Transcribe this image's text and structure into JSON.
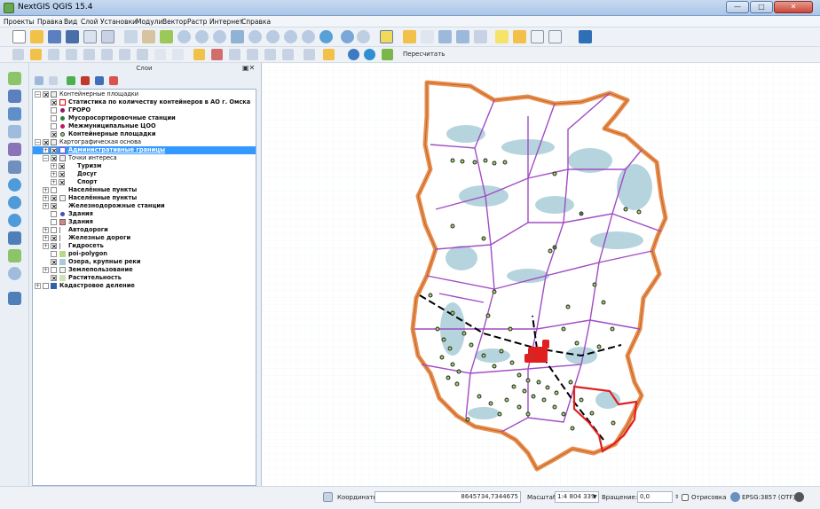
{
  "window": {
    "title": "NextGIS QGIS 15.4",
    "minimize": "—",
    "maximize": "□",
    "close": "✕"
  },
  "menu": [
    "Проекты",
    "Правка",
    "Вид",
    "Слой",
    "Установки",
    "Модули",
    "Вектор",
    "Растр",
    "Интернет",
    "Справка"
  ],
  "toolbar": {
    "recalculate_label": "Пересчитать"
  },
  "layers_panel": {
    "title": "Слои",
    "close_label": "▣✕",
    "items": [
      {
        "label": "Контейнерные площадки",
        "bold": false
      },
      {
        "label": "Статистика по количеству контейнеров в АО г. Омска",
        "bold": true
      },
      {
        "label": "ГРОРО",
        "bold": true
      },
      {
        "label": "Мусоросортировочные станции",
        "bold": true
      },
      {
        "label": "Межмуниципальные ЦОО",
        "bold": true
      },
      {
        "label": "Контейнерные площадки",
        "bold": true
      },
      {
        "label": "Картографическая основа",
        "bold": false
      },
      {
        "label": "Административные границы",
        "bold": true
      },
      {
        "label": "Точки интереса",
        "bold": false
      },
      {
        "label": "Туризм",
        "bold": true
      },
      {
        "label": "Досуг",
        "bold": true
      },
      {
        "label": "Спорт",
        "bold": true
      },
      {
        "label": "Населённые пункты",
        "bold": true
      },
      {
        "label": "Населённые пункты",
        "bold": true
      },
      {
        "label": "Железнодорожные станции",
        "bold": true
      },
      {
        "label": "Здания",
        "bold": true
      },
      {
        "label": "Здания",
        "bold": true
      },
      {
        "label": "Автодороги",
        "bold": true
      },
      {
        "label": "Железные дороги",
        "bold": true
      },
      {
        "label": "Гидросеть",
        "bold": true
      },
      {
        "label": "poi-polygon",
        "bold": true
      },
      {
        "label": "Озера, крупные реки",
        "bold": true
      },
      {
        "label": "Землепользование",
        "bold": true
      },
      {
        "label": "Растительность",
        "bold": true
      },
      {
        "label": "Кадастровое деление",
        "bold": true
      }
    ]
  },
  "status_bar": {
    "coordinates_label": "Координаты:",
    "coordinates_value": "8645734,7344675",
    "scale_label": "Масштаб",
    "scale_value": "1:4 804 339",
    "rotation_label": "Вращение:",
    "rotation_value": "0,0",
    "render_label": "Отрисовка",
    "crs_label": "EPSG:3857 (OTF)"
  },
  "colors": {
    "region_outline": "#e8833a",
    "district_borders": "#a24bc4",
    "water": "#a9cdd8",
    "selected_district": "#e02020",
    "container_sites": "#9fd26a",
    "railway": "#000000",
    "selection": "#3399ff"
  }
}
